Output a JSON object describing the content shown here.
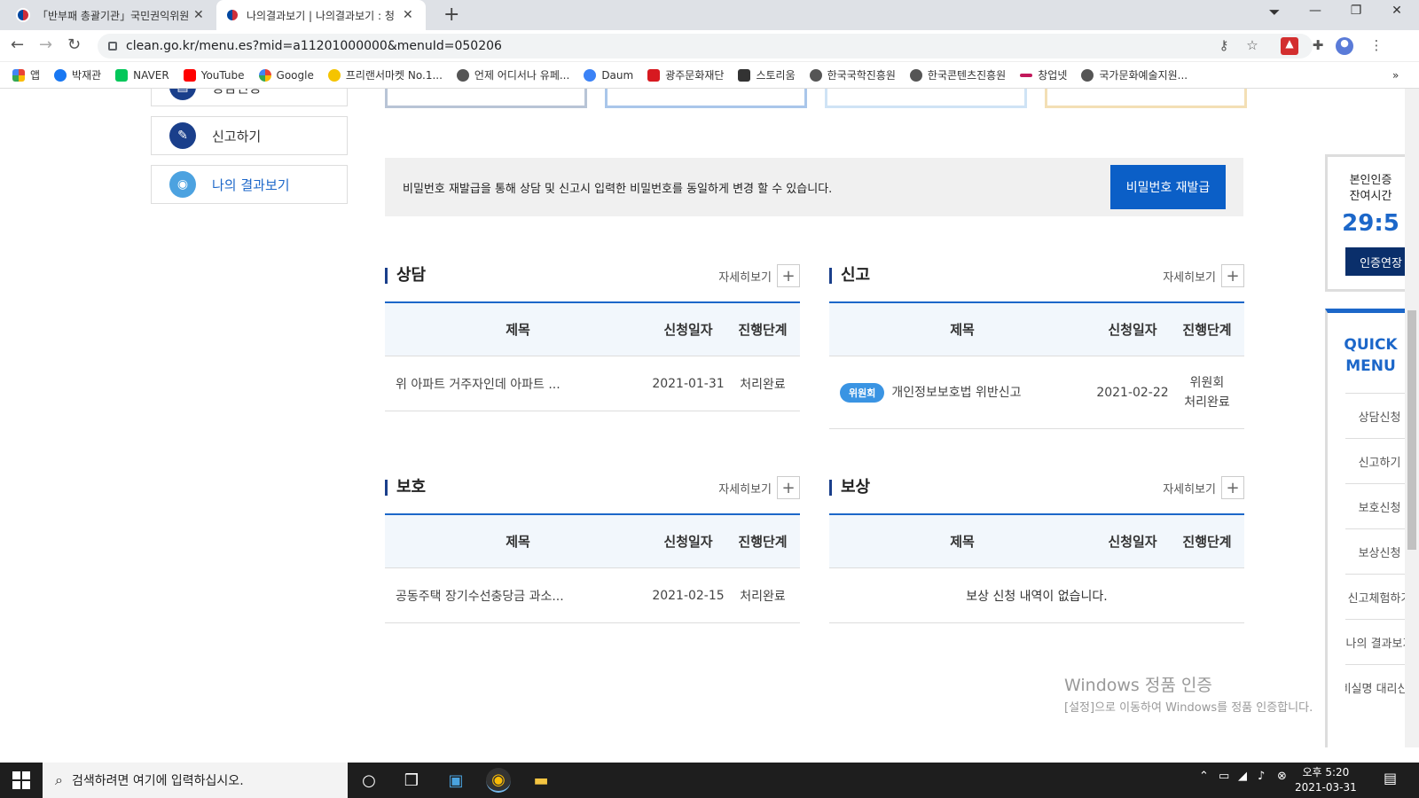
{
  "browser": {
    "tabs": [
      {
        "title": "「반부패 총괄기관」국민권익위원",
        "close": "✕"
      },
      {
        "title": "나의결과보기 | 나의결과보기 : 청",
        "close": "✕"
      }
    ],
    "new_tab": "+",
    "url": "clean.go.kr/menu.es?mid=a11201000000&menuId=050206",
    "bookmarks": [
      {
        "label": "앱",
        "color": "#e94235"
      },
      {
        "label": "박재관",
        "color": "#1877f2"
      },
      {
        "label": "NAVER",
        "color": "#03c75a"
      },
      {
        "label": "YouTube",
        "color": "#ff0000"
      },
      {
        "label": "Google",
        "color": "#4285f4"
      },
      {
        "label": "프리랜서마켓 No.1...",
        "color": "#f5c400"
      },
      {
        "label": "언제 어디서나 유페...",
        "color": "#555555"
      },
      {
        "label": "Daum",
        "color": "#3b82f6"
      },
      {
        "label": "광주문화재단",
        "color": "#d71920"
      },
      {
        "label": "스토리움",
        "color": "#333333"
      },
      {
        "label": "한국국학진흥원",
        "color": "#555555"
      },
      {
        "label": "한국콘텐츠진흥원",
        "color": "#555555"
      },
      {
        "label": "창업넷",
        "color": "#c2185b"
      },
      {
        "label": "국가문화예술지원...",
        "color": "#555555"
      }
    ],
    "bookmarks_more": "»"
  },
  "sidebar": {
    "items": [
      {
        "label": "상담신청",
        "icon": "doc-icon"
      },
      {
        "label": "신고하기",
        "icon": "chat-icon"
      },
      {
        "label": "나의 결과보기",
        "icon": "eye-icon"
      }
    ]
  },
  "notice": {
    "text": "비밀번호 재발급을 통해 상담 및 신고시 입력한 비밀번호를 동일하게 변경 할 수 있습니다.",
    "button": "비밀번호 재발급"
  },
  "panels": {
    "consult": {
      "title": "상담",
      "more": "자세히보기",
      "plus": "+",
      "headers": [
        "제목",
        "신청일자",
        "진행단계"
      ],
      "rows": [
        {
          "title": "위 아파트 거주자인데 아파트 ...",
          "date": "2021-01-31",
          "status": "처리완료"
        }
      ]
    },
    "report": {
      "title": "신고",
      "more": "자세히보기",
      "plus": "+",
      "headers": [
        "제목",
        "신청일자",
        "진행단계"
      ],
      "rows": [
        {
          "badge": "위원회",
          "title": "개인정보보호법 위반신고",
          "date": "2021-02-22",
          "status1": "위원회",
          "status2": "처리완료"
        }
      ]
    },
    "protect": {
      "title": "보호",
      "more": "자세히보기",
      "plus": "+",
      "headers": [
        "제목",
        "신청일자",
        "진행단계"
      ],
      "rows": [
        {
          "title": "공동주택 장기수선충당금 과소...",
          "date": "2021-02-15",
          "status": "처리완료"
        }
      ]
    },
    "reward": {
      "title": "보상",
      "more": "자세히보기",
      "plus": "+",
      "headers": [
        "제목",
        "신청일자",
        "진행단계"
      ],
      "empty": "보상 신청 내역이 없습니다."
    }
  },
  "auth": {
    "label1": "본인인증",
    "label2": "잔여시간",
    "time": "29:5",
    "extend": "인증연장"
  },
  "quick": {
    "title1": "QUICK",
    "title2": "MENU",
    "items": [
      "상담신청",
      "신고하기",
      "보호신청",
      "보상신청",
      "신고체험하기",
      "나의 결과보기",
      "비실명 대리신고"
    ]
  },
  "watermark": {
    "line1": "Windows 정품 인증",
    "line2": "[설정]으로 이동하여 Windows를 정품 인증합니다."
  },
  "taskbar": {
    "search_placeholder": "검색하려면 여기에 입력하십시오.",
    "time": "오후 5:20",
    "date": "2021-03-31"
  }
}
